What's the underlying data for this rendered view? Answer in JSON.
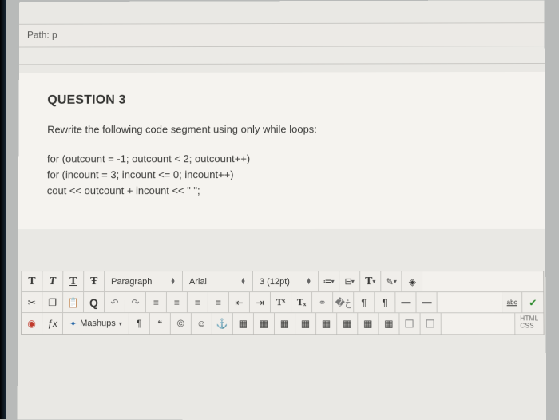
{
  "path": {
    "label": "Path: p"
  },
  "question": {
    "title": "QUESTION 3",
    "prompt": "Rewrite the following code segment using only while loops:",
    "code_line1": "for (outcount = -1; outcount < 2; outcount++)",
    "code_line2": "for (incount = 3; incount <= 0; incount++)",
    "code_line3": "cout << outcount + incount << \" \";"
  },
  "toolbar": {
    "row1": {
      "t1": "T",
      "t2": "T",
      "t3": "T",
      "t4": "Ŧ",
      "format_label": "Paragraph",
      "font_label": "Arial",
      "size_label": "3 (12pt)",
      "bullets": "≔",
      "numlist": "⊟",
      "textstyle": "T",
      "pen": "✎",
      "diamond": "◈"
    },
    "row2": {
      "cut": "✂",
      "copy": "❐",
      "paste": "📋",
      "find": "Q",
      "undo": "↶",
      "redo": "↷",
      "alignL": "≡",
      "alignC": "≡",
      "alignR": "≡",
      "alignJ": "≡",
      "indentOut": "⇤",
      "indentIn": "⇥",
      "sup": "Tˣ",
      "sub": "Tₓ",
      "link": "⚭",
      "linkoff": "�ځ",
      "ltr": "¶",
      "rtl": "¶",
      "d1": "—",
      "d2": "—",
      "abc": "abc",
      "check": "✔"
    },
    "row3": {
      "rec": "◉",
      "fx": "ƒx",
      "mashups_label": "Mashups",
      "para": "¶",
      "quote": "❝",
      "copyright": "©",
      "smile": "☺",
      "anchor": "⚓",
      "grid": "▦",
      "html": "HTML",
      "css": "CSS"
    }
  }
}
